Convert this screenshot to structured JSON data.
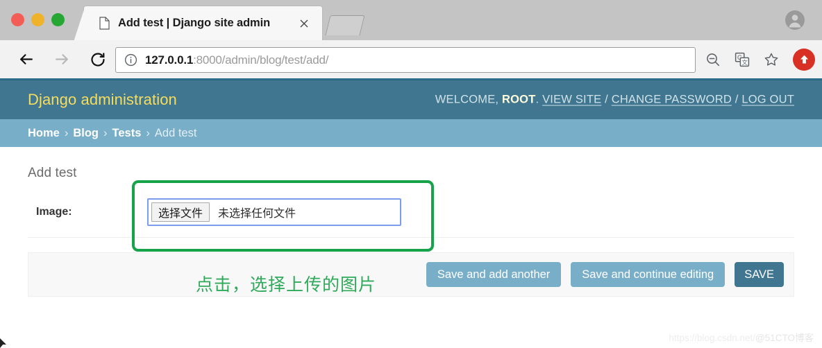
{
  "browser": {
    "tab": {
      "title": "Add test | Django site admin",
      "favicon_icon": "page-document-icon",
      "close_icon": "close-icon"
    },
    "profile_icon": "account-circle-icon",
    "nav": {
      "back_icon": "arrow-back-icon",
      "forward_icon": "arrow-forward-icon",
      "reload_icon": "reload-icon"
    },
    "omnibox": {
      "info_icon": "info-circle-icon",
      "url_host": "127.0.0.1",
      "url_path": ":8000/admin/blog/test/add/",
      "full_url": "127.0.0.1:8000/admin/blog/test/add/"
    },
    "toolbar_icons": {
      "zoom_out": "zoom-out-icon",
      "translate": "google-translate-icon",
      "bookmark": "star-outline-icon",
      "update": "update-arrow-icon"
    }
  },
  "django": {
    "branding": "Django administration",
    "user_tools": {
      "welcome_prefix": "WELCOME,",
      "username": "ROOT",
      "period": ".",
      "view_site": "VIEW SITE",
      "change_password": "CHANGE PASSWORD",
      "log_out": "LOG OUT",
      "separator": "/"
    },
    "breadcrumbs": {
      "items": [
        "Home",
        "Blog",
        "Tests"
      ],
      "current": "Add test",
      "separator": "›"
    },
    "page_title": "Add test",
    "form": {
      "image_label": "Image:",
      "file_button": "选择文件",
      "file_status": "未选择任何文件"
    },
    "submit_row": {
      "save_and_add_another": "Save and add another",
      "save_and_continue": "Save and continue editing",
      "save": "SAVE"
    }
  },
  "annotations": {
    "callout_text": "点击，选择上传的图片",
    "box_color": "#16a34a",
    "text_color": "#2eaa5a"
  },
  "watermark": {
    "url": "https://blog.csdn.net/",
    "handle": "@51CTO博客"
  },
  "colors": {
    "django_header": "#417690",
    "django_breadcrumb": "#79aec8",
    "django_brand_text": "#f5dd5d",
    "button_primary": "#79aec8",
    "button_default": "#417690",
    "update_button": "#d93025",
    "file_input_focus": "#7b9cec"
  }
}
